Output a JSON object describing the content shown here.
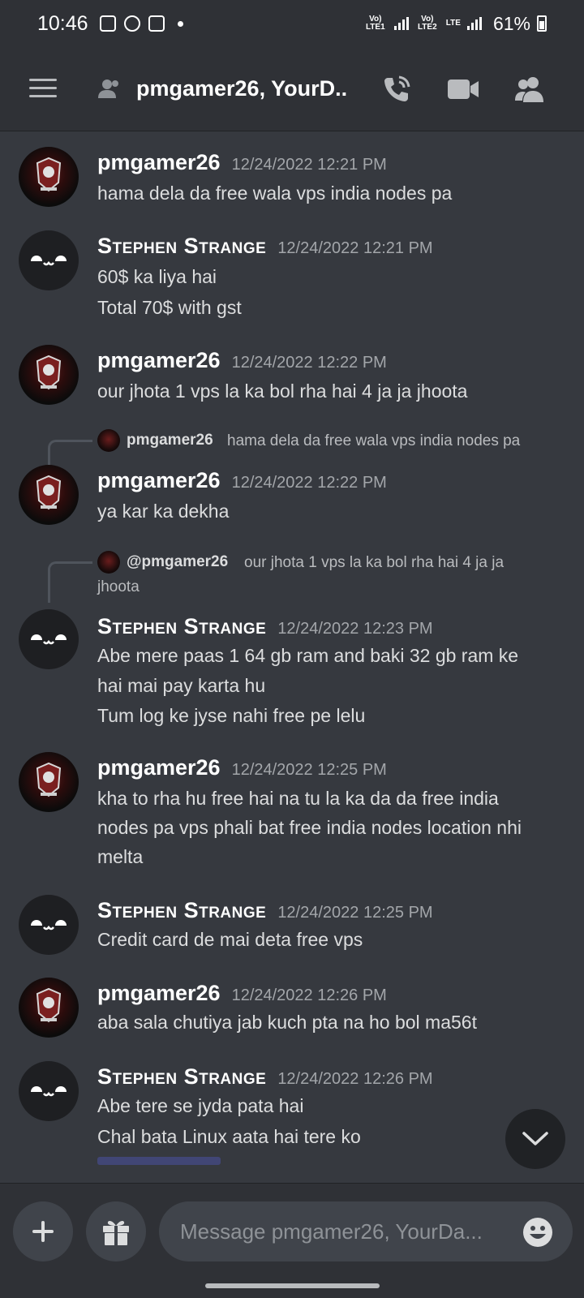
{
  "status_bar": {
    "time": "10:46",
    "sim1_label": "Vo) LTE1",
    "sim2_label": "Vo) LTE2",
    "network_type": "LTE",
    "battery": "61%"
  },
  "header": {
    "title": "pmgamer26, YourD..",
    "icons": [
      "menu-icon",
      "group-icon",
      "phone-call-icon",
      "video-camera-icon",
      "members-icon"
    ]
  },
  "messages": [
    {
      "author": "pmgamer26",
      "timestamp": "12/24/2022 12:21 PM",
      "lines": [
        "hama dela da free wala vps india nodes pa"
      ]
    },
    {
      "author": "Stephen Strange",
      "timestamp": "12/24/2022 12:21 PM",
      "lines": [
        "60$ ka liya hai",
        "Total 70$ with gst"
      ]
    },
    {
      "author": "pmgamer26",
      "timestamp": "12/24/2022 12:22 PM",
      "lines": [
        "our jhota 1 vps la ka bol rha hai 4 ja ja jhoota"
      ]
    },
    {
      "reply": {
        "name": "pmgamer26",
        "text": "hama dela da free wala vps india nodes pa"
      },
      "author": "pmgamer26",
      "timestamp": "12/24/2022 12:22 PM",
      "lines": [
        "ya kar ka dekha"
      ]
    },
    {
      "reply": {
        "name": "@pmgamer26",
        "text": "our jhota 1 vps la ka bol rha hai 4 ja ja",
        "text2": "jhoota"
      },
      "author": "Stephen Strange",
      "timestamp": "12/24/2022 12:23 PM",
      "lines": [
        "Abe mere paas 1 64 gb ram and baki 32 gb ram ke",
        "hai mai pay karta hu",
        "Tum log ke jyse nahi free pe lelu"
      ]
    },
    {
      "author": "pmgamer26",
      "timestamp": "12/24/2022 12:25 PM",
      "lines": [
        "kha to rha hu free hai na tu la ka da da free india",
        "nodes pa vps phali bat free india nodes location nhi",
        "melta"
      ]
    },
    {
      "author": "Stephen Strange",
      "timestamp": "12/24/2022 12:25 PM",
      "lines": [
        "Credit card de mai deta free vps"
      ]
    },
    {
      "author": "pmgamer26",
      "timestamp": "12/24/2022 12:26 PM",
      "lines": [
        "aba sala chutiya jab kuch pta na ho bol ma56t"
      ]
    },
    {
      "author": "Stephen Strange",
      "timestamp": "12/24/2022 12:26 PM",
      "lines": [
        "Abe tere se jyda pata hai",
        "Chal bata Linux aata hai tere ko"
      ]
    }
  ],
  "composer": {
    "placeholder": "Message pmgamer26, YourDa...",
    "icons": [
      "plus-icon",
      "gift-icon",
      "emoji-icon"
    ]
  },
  "colors": {
    "background": "#36393f",
    "header": "#2f3136",
    "input": "#40444b",
    "text": "#dcddde",
    "muted": "#a3a6aa"
  }
}
